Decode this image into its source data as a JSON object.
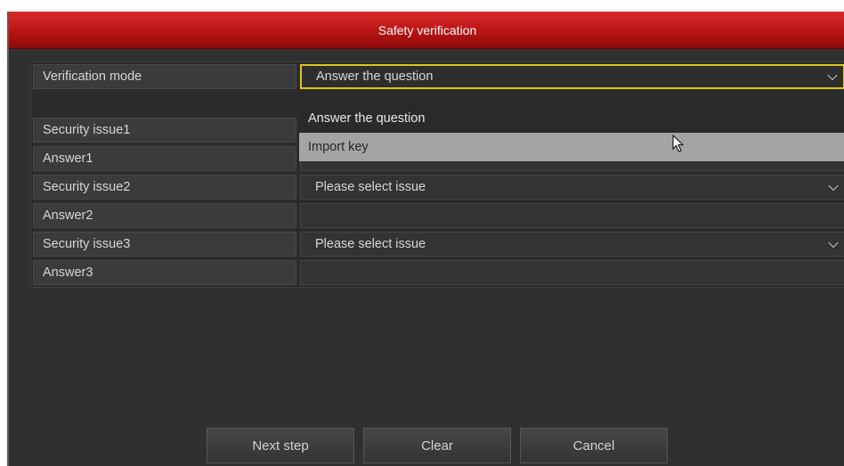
{
  "window": {
    "title": "Safety verification"
  },
  "form": {
    "rows": [
      {
        "label": "Verification mode",
        "value": "Answer the question",
        "type": "select"
      },
      {
        "label": "Security issue1",
        "value": "",
        "type": "select"
      },
      {
        "label": "Answer1",
        "value": "",
        "type": "input"
      },
      {
        "label": "Security issue2",
        "value": "Please select issue",
        "type": "select"
      },
      {
        "label": "Answer2",
        "value": "",
        "type": "input"
      },
      {
        "label": "Security issue3",
        "value": "Please select issue",
        "type": "select"
      },
      {
        "label": "Answer3",
        "value": "",
        "type": "input"
      }
    ]
  },
  "dropdown": {
    "options": [
      "Answer the question",
      "Import key"
    ],
    "hovered_index": 1
  },
  "buttons": {
    "next": "Next step",
    "clear": "Clear",
    "cancel": "Cancel"
  },
  "colors": {
    "title_bar": "#c41c1c",
    "focus_border": "#e0c419",
    "panel_bg": "#303030",
    "hover_bg": "#a4a4a4"
  },
  "icons": [
    "chevron-down-icon",
    "mouse-pointer-icon"
  ]
}
